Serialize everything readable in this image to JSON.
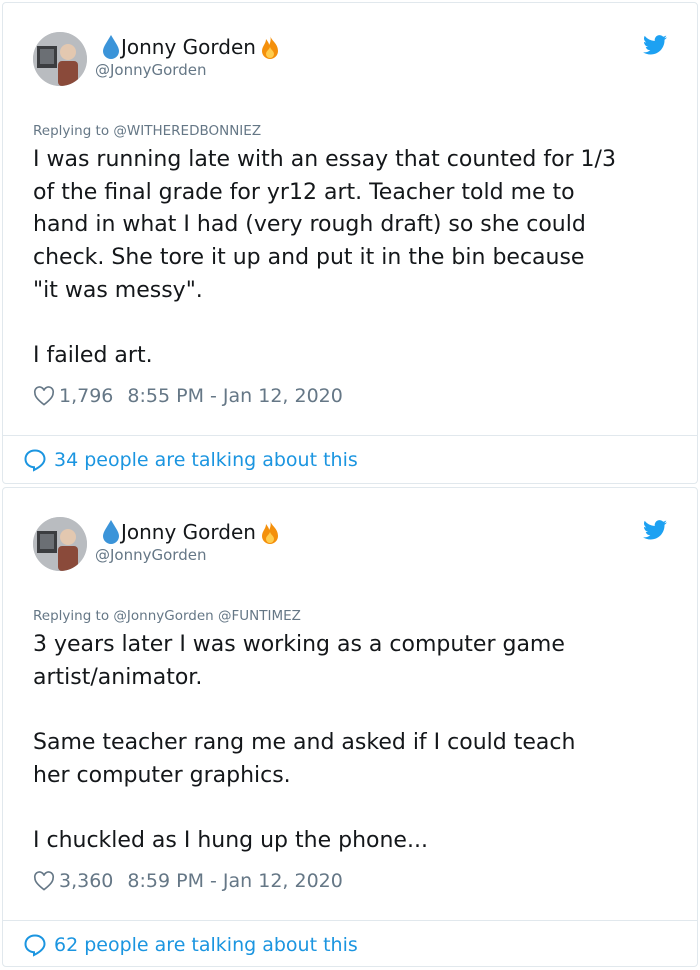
{
  "tweets": [
    {
      "user_name": "Jonny Gorden",
      "handle": "@JonnyGorden",
      "replying_to": "Replying to @WITHEREDBONNIEZ",
      "text": "I was running late with an essay that counted for 1/3\nof the final grade for yr12 art. Teacher told me to\nhand in what I had (very rough draft) so she could\ncheck. She tore it up and put it in the bin because\n\"it was messy\".\n\nI failed art.",
      "likes": "1,796",
      "timestamp": "8:55 PM - Jan 12, 2020",
      "talking": "34 people are talking about this"
    },
    {
      "user_name": "Jonny Gorden",
      "handle": "@JonnyGorden",
      "replying_to": "Replying to @JonnyGorden @FUNTIMEZ",
      "text": "3 years later I was working as a computer game\nartist/animator.\n\nSame teacher rang me and asked if I could teach\nher computer graphics.\n\nI chuckled as I hung up the phone...",
      "likes": "3,360",
      "timestamp": "8:59 PM - Jan 12, 2020",
      "talking": "62 people are talking about this"
    }
  ],
  "colors": {
    "accent": "#1b95e0",
    "muted": "#657786",
    "text": "#14171a",
    "border": "#e1e8ed"
  },
  "icons": [
    "water-drop-icon",
    "fire-icon",
    "twitter-bird-icon",
    "heart-icon",
    "speech-bubble-icon"
  ]
}
